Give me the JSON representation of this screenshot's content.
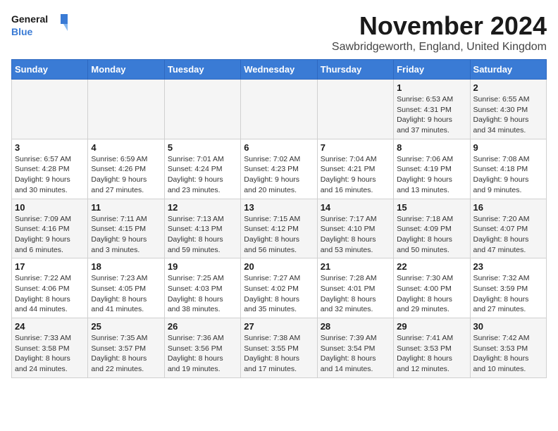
{
  "logo": {
    "line1": "General",
    "line2": "Blue"
  },
  "title": "November 2024",
  "location": "Sawbridgeworth, England, United Kingdom",
  "headers": [
    "Sunday",
    "Monday",
    "Tuesday",
    "Wednesday",
    "Thursday",
    "Friday",
    "Saturday"
  ],
  "weeks": [
    [
      {
        "day": "",
        "info": ""
      },
      {
        "day": "",
        "info": ""
      },
      {
        "day": "",
        "info": ""
      },
      {
        "day": "",
        "info": ""
      },
      {
        "day": "",
        "info": ""
      },
      {
        "day": "1",
        "info": "Sunrise: 6:53 AM\nSunset: 4:31 PM\nDaylight: 9 hours\nand 37 minutes."
      },
      {
        "day": "2",
        "info": "Sunrise: 6:55 AM\nSunset: 4:30 PM\nDaylight: 9 hours\nand 34 minutes."
      }
    ],
    [
      {
        "day": "3",
        "info": "Sunrise: 6:57 AM\nSunset: 4:28 PM\nDaylight: 9 hours\nand 30 minutes."
      },
      {
        "day": "4",
        "info": "Sunrise: 6:59 AM\nSunset: 4:26 PM\nDaylight: 9 hours\nand 27 minutes."
      },
      {
        "day": "5",
        "info": "Sunrise: 7:01 AM\nSunset: 4:24 PM\nDaylight: 9 hours\nand 23 minutes."
      },
      {
        "day": "6",
        "info": "Sunrise: 7:02 AM\nSunset: 4:23 PM\nDaylight: 9 hours\nand 20 minutes."
      },
      {
        "day": "7",
        "info": "Sunrise: 7:04 AM\nSunset: 4:21 PM\nDaylight: 9 hours\nand 16 minutes."
      },
      {
        "day": "8",
        "info": "Sunrise: 7:06 AM\nSunset: 4:19 PM\nDaylight: 9 hours\nand 13 minutes."
      },
      {
        "day": "9",
        "info": "Sunrise: 7:08 AM\nSunset: 4:18 PM\nDaylight: 9 hours\nand 9 minutes."
      }
    ],
    [
      {
        "day": "10",
        "info": "Sunrise: 7:09 AM\nSunset: 4:16 PM\nDaylight: 9 hours\nand 6 minutes."
      },
      {
        "day": "11",
        "info": "Sunrise: 7:11 AM\nSunset: 4:15 PM\nDaylight: 9 hours\nand 3 minutes."
      },
      {
        "day": "12",
        "info": "Sunrise: 7:13 AM\nSunset: 4:13 PM\nDaylight: 8 hours\nand 59 minutes."
      },
      {
        "day": "13",
        "info": "Sunrise: 7:15 AM\nSunset: 4:12 PM\nDaylight: 8 hours\nand 56 minutes."
      },
      {
        "day": "14",
        "info": "Sunrise: 7:17 AM\nSunset: 4:10 PM\nDaylight: 8 hours\nand 53 minutes."
      },
      {
        "day": "15",
        "info": "Sunrise: 7:18 AM\nSunset: 4:09 PM\nDaylight: 8 hours\nand 50 minutes."
      },
      {
        "day": "16",
        "info": "Sunrise: 7:20 AM\nSunset: 4:07 PM\nDaylight: 8 hours\nand 47 minutes."
      }
    ],
    [
      {
        "day": "17",
        "info": "Sunrise: 7:22 AM\nSunset: 4:06 PM\nDaylight: 8 hours\nand 44 minutes."
      },
      {
        "day": "18",
        "info": "Sunrise: 7:23 AM\nSunset: 4:05 PM\nDaylight: 8 hours\nand 41 minutes."
      },
      {
        "day": "19",
        "info": "Sunrise: 7:25 AM\nSunset: 4:03 PM\nDaylight: 8 hours\nand 38 minutes."
      },
      {
        "day": "20",
        "info": "Sunrise: 7:27 AM\nSunset: 4:02 PM\nDaylight: 8 hours\nand 35 minutes."
      },
      {
        "day": "21",
        "info": "Sunrise: 7:28 AM\nSunset: 4:01 PM\nDaylight: 8 hours\nand 32 minutes."
      },
      {
        "day": "22",
        "info": "Sunrise: 7:30 AM\nSunset: 4:00 PM\nDaylight: 8 hours\nand 29 minutes."
      },
      {
        "day": "23",
        "info": "Sunrise: 7:32 AM\nSunset: 3:59 PM\nDaylight: 8 hours\nand 27 minutes."
      }
    ],
    [
      {
        "day": "24",
        "info": "Sunrise: 7:33 AM\nSunset: 3:58 PM\nDaylight: 8 hours\nand 24 minutes."
      },
      {
        "day": "25",
        "info": "Sunrise: 7:35 AM\nSunset: 3:57 PM\nDaylight: 8 hours\nand 22 minutes."
      },
      {
        "day": "26",
        "info": "Sunrise: 7:36 AM\nSunset: 3:56 PM\nDaylight: 8 hours\nand 19 minutes."
      },
      {
        "day": "27",
        "info": "Sunrise: 7:38 AM\nSunset: 3:55 PM\nDaylight: 8 hours\nand 17 minutes."
      },
      {
        "day": "28",
        "info": "Sunrise: 7:39 AM\nSunset: 3:54 PM\nDaylight: 8 hours\nand 14 minutes."
      },
      {
        "day": "29",
        "info": "Sunrise: 7:41 AM\nSunset: 3:53 PM\nDaylight: 8 hours\nand 12 minutes."
      },
      {
        "day": "30",
        "info": "Sunrise: 7:42 AM\nSunset: 3:53 PM\nDaylight: 8 hours\nand 10 minutes."
      }
    ]
  ]
}
